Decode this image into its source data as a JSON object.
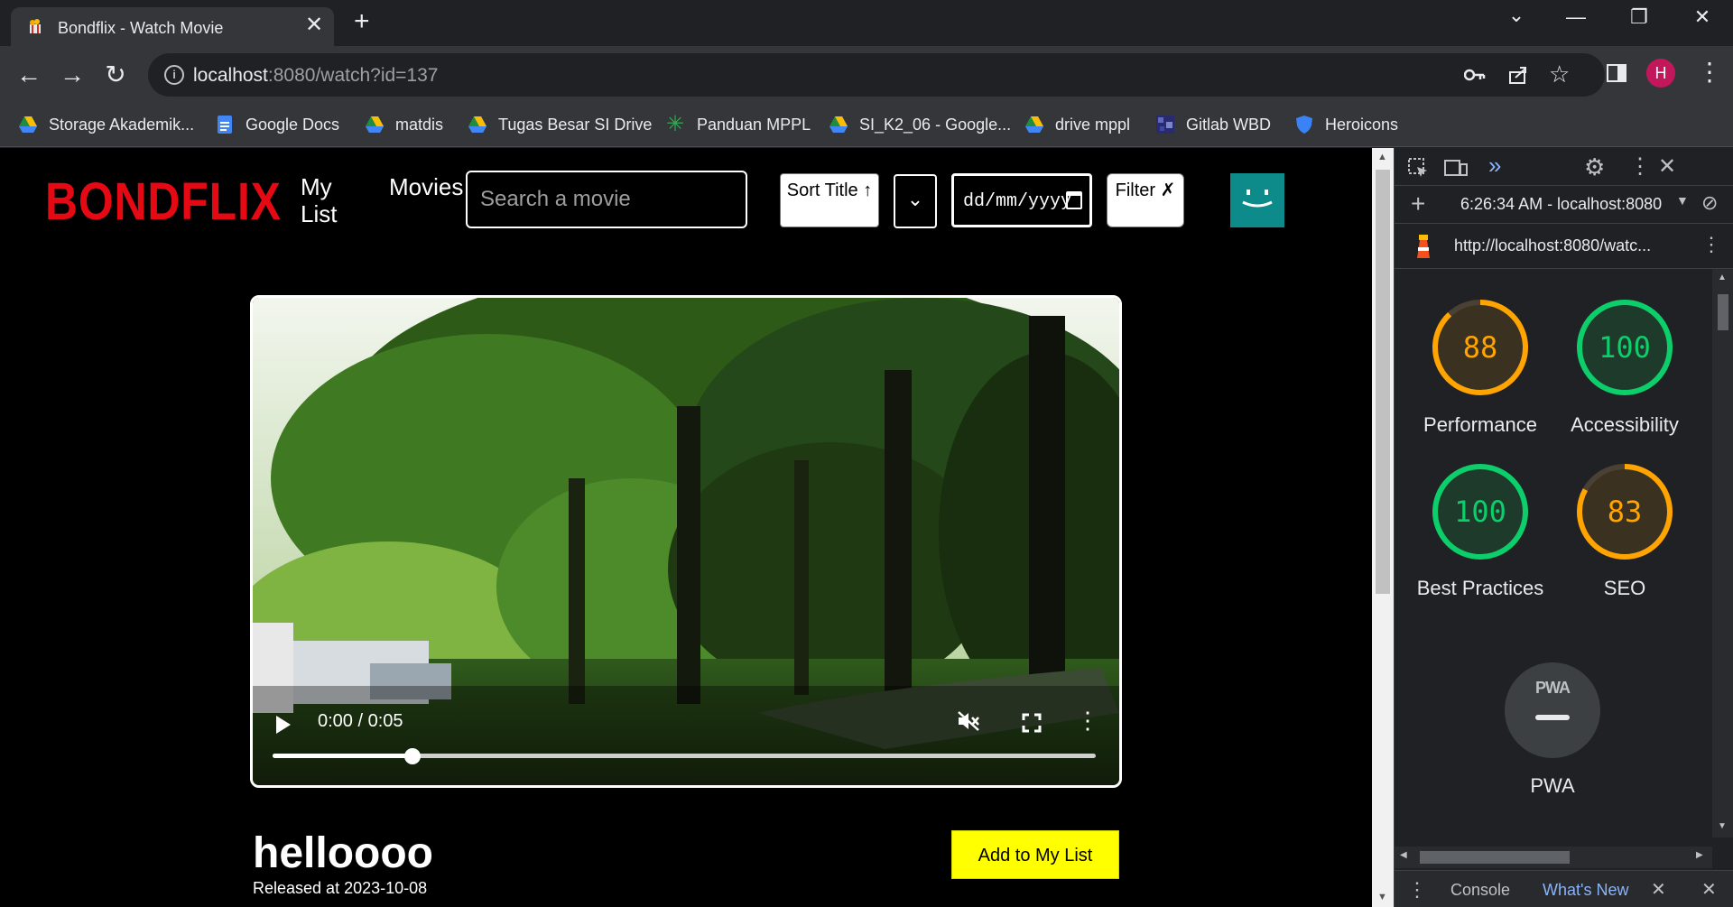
{
  "browser": {
    "tab_title": "Bondflix - Watch Movie",
    "tab_close": "✕",
    "new_tab": "+",
    "url_host": "localhost",
    "url_rest": ":8080/watch?id=137",
    "avatar_letter": "H",
    "bookmarks": [
      {
        "label": "Storage Akademik...",
        "icon": "google-drive-icon"
      },
      {
        "label": "Google Docs",
        "icon": "google-docs-icon"
      },
      {
        "label": "matdis",
        "icon": "google-drive-icon"
      },
      {
        "label": "Tugas Besar SI Drive",
        "icon": "google-drive-icon"
      },
      {
        "label": "Panduan MPPL",
        "icon": "asterisk-icon"
      },
      {
        "label": "SI_K2_06 - Google...",
        "icon": "google-drive-icon"
      },
      {
        "label": "drive mppl",
        "icon": "google-drive-icon"
      },
      {
        "label": "Gitlab WBD",
        "icon": "gitlab-icon"
      },
      {
        "label": "Heroicons",
        "icon": "shield-icon"
      }
    ]
  },
  "app": {
    "logo": "BONDFLIX",
    "nav_my_list": "My List",
    "nav_movies": "Movies",
    "search_placeholder": "Search a movie",
    "sort_label": "Sort Title ↑",
    "date_placeholder": "dd/mm/yyyy",
    "filter_label": "Filter ✗",
    "select_value": "⌄",
    "profile_face": "‿"
  },
  "player": {
    "time": "0:00 / 0:05",
    "progress": 0.17,
    "muted": true
  },
  "movie": {
    "title": "helloooo",
    "released": "Released at 2023-10-08",
    "add_button": "Add to My List"
  },
  "devtools": {
    "timestamp": "6:26:34 AM - localhost:8080",
    "report_url": "http://localhost:8080/watc...",
    "scores": [
      {
        "label": "Performance",
        "value": "88",
        "color": "#ffa400"
      },
      {
        "label": "Accessibility",
        "value": "100",
        "color": "#0cce6b"
      },
      {
        "label": "Best Practices",
        "value": "100",
        "color": "#0cce6b"
      },
      {
        "label": "SEO",
        "value": "83",
        "color": "#ffa400"
      }
    ],
    "pwa_badge": "PWA",
    "pwa_label": "PWA",
    "drawer_console": "Console",
    "drawer_whats_new": "What's New"
  }
}
